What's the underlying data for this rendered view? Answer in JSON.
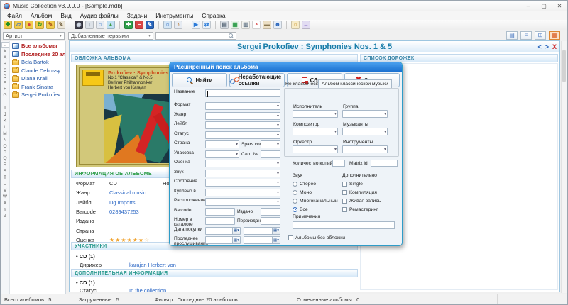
{
  "window": {
    "title": "Music Collection v3.9.0.0 - [Sample.mdb]",
    "minimize": "–",
    "maximize": "▢",
    "close": "✕"
  },
  "menu": [
    "Файл",
    "Альбом",
    "Вид",
    "Аудио файлы",
    "Задачи",
    "Инструменты",
    "Справка"
  ],
  "toolbar": [
    {
      "name": "new-collection-icon",
      "glyph": "✚",
      "bg": "#f2cc4e",
      "fg": "#1f8f1f"
    },
    {
      "name": "open-collection-icon",
      "glyph": "▱",
      "bg": "#f2cc4e",
      "fg": "#4a78c0"
    },
    {
      "name": "repair-collection-icon",
      "glyph": "●",
      "bg": "#f2cc4e",
      "fg": "#d24040"
    },
    {
      "name": "sync-collection-icon",
      "glyph": "↻",
      "bg": "#f2cc4e",
      "fg": "#1f8f1f"
    },
    {
      "name": "tools-collection-icon",
      "glyph": "✎",
      "bg": "#f2cc4e",
      "fg": "#b06020"
    },
    {
      "name": "edit-fields-icon",
      "glyph": "✎",
      "bg": "#ece6d8",
      "fg": "#7a6848"
    },
    {
      "name": "separator"
    },
    {
      "name": "cd-rip-icon",
      "glyph": "◉",
      "bg": "#3c3c48",
      "fg": "#d0d8e4"
    },
    {
      "name": "download-icon",
      "glyph": "↓",
      "bg": "#dde2e8",
      "fg": "#5a6a7a"
    },
    {
      "name": "search-files-icon",
      "glyph": "○",
      "bg": "#e6ebf2",
      "fg": "#3a7ac8"
    },
    {
      "name": "pictures-icon",
      "glyph": "▲",
      "bg": "#bfe0f2",
      "fg": "#3f9a3f"
    },
    {
      "name": "separator"
    },
    {
      "name": "add-album-icon",
      "glyph": "✚",
      "bg": "#2fa04a",
      "fg": "#ffffff"
    },
    {
      "name": "remove-album-icon",
      "glyph": "−",
      "bg": "#d84444",
      "fg": "#ffffff"
    },
    {
      "name": "edit-album-icon",
      "glyph": "✎",
      "bg": "#2a66bc",
      "fg": "#ffffff"
    },
    {
      "name": "separator"
    },
    {
      "name": "quick-view-icon",
      "glyph": "○",
      "bg": "#d4e6f6",
      "fg": "#2a66bc"
    },
    {
      "name": "audio-search-icon",
      "glyph": "♪",
      "bg": "#e6ebf2",
      "fg": "#b8742a"
    },
    {
      "name": "separator"
    },
    {
      "name": "play-icon",
      "glyph": "▶",
      "bg": "#eaf2fa",
      "fg": "#2a7ad8"
    },
    {
      "name": "shuffle-icon",
      "glyph": "⇄",
      "bg": "#eaf2fa",
      "fg": "#2a7ad8"
    },
    {
      "name": "separator"
    },
    {
      "name": "print-icon",
      "glyph": "▤",
      "bg": "#dde2e8",
      "fg": "#5a6a7a"
    },
    {
      "name": "report-icon",
      "glyph": "▦",
      "bg": "#eaf6ea",
      "fg": "#2f9e4a"
    },
    {
      "name": "export-icon",
      "glyph": "▥",
      "bg": "#f4f4f0",
      "fg": "#6a7a8a"
    },
    {
      "name": "statistics-icon",
      "glyph": "◔",
      "bg": "#ffffff",
      "fg": "#d84444"
    },
    {
      "name": "archive-icon",
      "glyph": "▬",
      "bg": "#ecdfc4",
      "fg": "#8a7852"
    },
    {
      "name": "loans-icon",
      "glyph": "☻",
      "bg": "#e6eef8",
      "fg": "#2a66bc"
    },
    {
      "name": "separator"
    },
    {
      "name": "help-icon",
      "glyph": "○",
      "bg": "#f8ecc8",
      "fg": "#c8922a"
    },
    {
      "name": "exit-icon",
      "glyph": "→",
      "bg": "#e2dcf2",
      "fg": "#6a4ab8"
    }
  ],
  "filter_bar": {
    "group_by": "Артист",
    "sort_by": "Добавленные первыми",
    "search_value": "",
    "view_buttons": [
      {
        "name": "report-view-icon",
        "glyph": "▤",
        "fg": "#4a78c0",
        "active": false
      },
      {
        "name": "list-view-icon",
        "glyph": "≡",
        "fg": "#4a78c0",
        "active": false
      },
      {
        "name": "thumbnails-view-icon",
        "glyph": "⊞",
        "fg": "#4a78c0",
        "active": false
      },
      {
        "name": "tiles-view-icon",
        "glyph": "▦",
        "fg": "#d85a20",
        "active": true
      }
    ]
  },
  "sidebar": {
    "more_button": "...",
    "alphabet": [
      "#",
      "A",
      "B",
      "C",
      "D",
      "E",
      "F",
      "G",
      "H",
      "I",
      "J",
      "K",
      "L",
      "M",
      "N",
      "O",
      "P",
      "Q",
      "R",
      "S",
      "T",
      "U",
      "V",
      "W",
      "X",
      "Y",
      "Z"
    ],
    "tree": [
      {
        "label": "Все альбомы",
        "type": "special"
      },
      {
        "label": "Последние 20 альбо...",
        "type": "special"
      },
      {
        "label": "Bela Bartok",
        "type": "artist"
      },
      {
        "label": "Claude Debussy",
        "type": "artist"
      },
      {
        "label": "Diana Krall",
        "type": "artist"
      },
      {
        "label": "Frank Sinatra",
        "type": "artist"
      },
      {
        "label": "Sergei Prokofiev",
        "type": "artist"
      }
    ]
  },
  "main": {
    "album_title": "Sergei Prokofiev : Symphonies Nos. 1 & 5",
    "nav_prev": "<",
    "nav_next": ">",
    "nav_close": "X",
    "cover_panel_header": "ОБЛОЖКА АЛЬБОМА",
    "tracks_panel_header": "СПИСОК ДОРОЖЕК",
    "cover": {
      "line1": "Prokofiev · Symphonies",
      "line2": "No.1 \"Classical\" & No.5",
      "line3": "Berliner Philharmoniker",
      "line4": "Herbert von Karajan"
    },
    "info": {
      "header": "ИНФОРМАЦИЯ ОБ АЛЬБОМЕ",
      "header_color": "#2f9e4a",
      "rows": [
        {
          "label": "Формат",
          "value": "CD",
          "link": false,
          "extra": "Носитель"
        },
        {
          "label": "Жанр",
          "value": "Classical music",
          "link": true
        },
        {
          "label": "Лейбл",
          "value": "Dg Imports",
          "link": true
        },
        {
          "label": "Barcode",
          "value": "0289437253",
          "link": true
        },
        {
          "label": "Издано",
          "value": "",
          "link": false
        },
        {
          "label": "Страна",
          "value": "",
          "link": false
        },
        {
          "label": "Оценка",
          "value": "",
          "link": false,
          "stars": {
            "filled": 6,
            "pale": 1
          }
        }
      ]
    },
    "participants": {
      "header": "УЧАСТНИКИ",
      "header_color": "#2a9a8f",
      "disc": "CD (1)",
      "role": "Дирижер",
      "name": "karajan Herbert von"
    },
    "additional": {
      "header": "ДОПОЛНИТЕЛЬНАЯ ИНФОРМАЦИЯ",
      "header_color": "#2a9a8f",
      "disc": "CD (1)",
      "role": "Статус",
      "name": "In the collection"
    }
  },
  "dialog": {
    "title": "Расширенный поиск альбома",
    "buttons": [
      {
        "name": "find-button",
        "label": "Найти",
        "icon": "mag"
      },
      {
        "name": "broken-links-button",
        "label": "Неработающие ссылки",
        "icon": "links"
      },
      {
        "name": "reset-button",
        "label": "Сброс",
        "icon": "reset"
      },
      {
        "name": "close-button",
        "label": "Закрыть",
        "icon": "close"
      }
    ],
    "close_glyph": "✖",
    "fields": [
      {
        "label": "Название",
        "type": "text"
      },
      {
        "label": "Формат",
        "type": "select"
      },
      {
        "label": "Жанр",
        "type": "select"
      },
      {
        "label": "Лейбл",
        "type": "select"
      },
      {
        "label": "Статус",
        "type": "select"
      },
      {
        "label": "Страна",
        "type": "select_select",
        "extra": "Spars code"
      },
      {
        "label": "Упаковка",
        "type": "select_text",
        "extra": "Слот №"
      },
      {
        "label": "Оценка",
        "type": "select"
      },
      {
        "label": "Звук",
        "type": "select"
      },
      {
        "label": "Состояние",
        "type": "select"
      },
      {
        "label": "Куплено в",
        "type": "select"
      },
      {
        "label": "Расположение",
        "type": "select"
      },
      {
        "label": "Barcode",
        "type": "text_text",
        "extra": "Издано"
      },
      {
        "label": "Номер в каталоге",
        "type": "text_text",
        "extra": "Переиздано"
      },
      {
        "label": "Дата покупки",
        "type": "date_pair"
      },
      {
        "label": "Последнее прослушивание",
        "type": "date_pair"
      }
    ],
    "tabs": {
      "inactive": "Не классический",
      "active": "Альбом классической музыки"
    },
    "classical_fields": [
      "Исполнитель",
      "Группа",
      "Композитор",
      "Музыканты",
      "Оркестр",
      "Инструменты"
    ],
    "copies_label": "Количество копий",
    "matrix_label": "Matrix id",
    "sound_header": "Звук",
    "sound_options": [
      {
        "label": "Стерео",
        "checked": false
      },
      {
        "label": "Моно",
        "checked": false
      },
      {
        "label": "Многоканальный",
        "checked": false
      },
      {
        "label": "Все",
        "checked": true
      }
    ],
    "extra_header": "Дополнительно",
    "extra_options": [
      "Single",
      "Компиляция",
      "Живая запись",
      "Ремастеринг"
    ],
    "notes_label": "Примечания",
    "no_cover_label": "Альбомы без обложки"
  },
  "status_bar": [
    "Всего альбомов : 5",
    "Загруженные : 5",
    "Фильтр : Последние 20 альбомов",
    "Отмеченные альбомы : 0"
  ]
}
